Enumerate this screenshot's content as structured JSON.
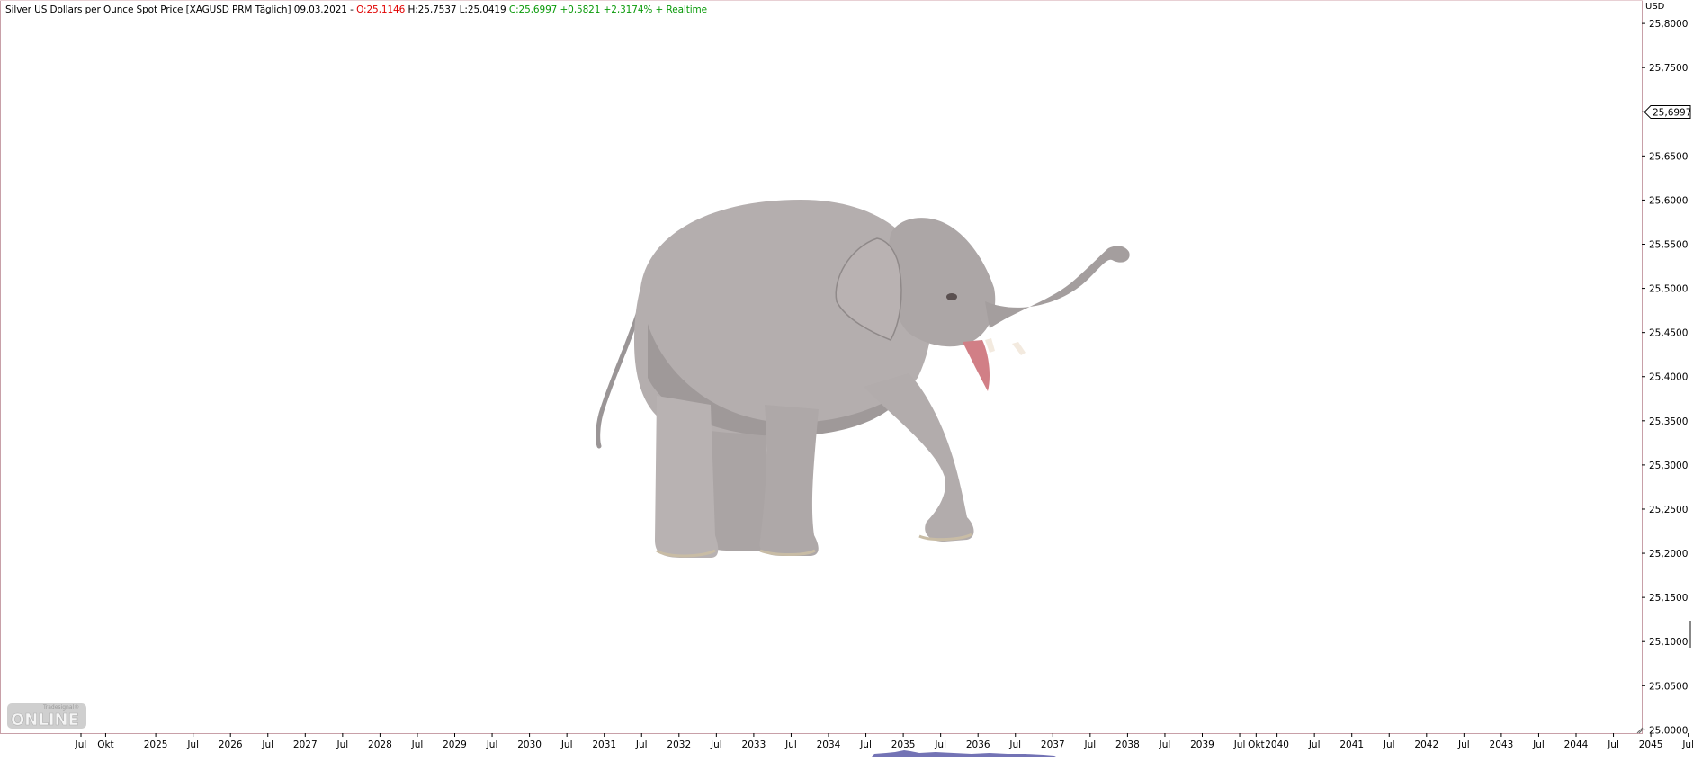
{
  "header": {
    "title": "Silver US Dollars per Ounce Spot Price [XAGUSD PRM Täglich]",
    "date": "09.03.2021",
    "dash": "-",
    "open": "O:25,1146",
    "high": "H:25,7537",
    "low": "L:25,0419",
    "close": "C:25,6997",
    "change": "+0,5821",
    "change_pct": "+2,3174%",
    "realtime": "+ Realtime"
  },
  "logo": {
    "small": "Tradesignal®",
    "big": "ONLINE"
  },
  "colors": {
    "positive": "#0a9a0a",
    "negative": "#e00000",
    "frame": "#c8a0a8",
    "axis": "#000000",
    "volume": "#5a5aa8"
  },
  "chart_data": {
    "type": "line",
    "title": "Silver US Dollars per Ounce Spot Price [XAGUSD PRM Täglich]",
    "currency": "USD",
    "last_price": "25,6997",
    "y_ticks": [
      "25,8000",
      "25,7500",
      "25,7000",
      "25,6500",
      "25,6000",
      "25,5500",
      "25,5000",
      "25,4500",
      "25,4000",
      "25,3500",
      "25,3000",
      "25,2500",
      "25,2000",
      "25,1500",
      "25,1000",
      "25,0500",
      "25,0000"
    ],
    "y_values": [
      25.8,
      25.75,
      25.7,
      25.65,
      25.6,
      25.55,
      25.5,
      25.45,
      25.4,
      25.35,
      25.3,
      25.25,
      25.2,
      25.15,
      25.1,
      25.05,
      25.0
    ],
    "last_value": 25.6997,
    "ylim": [
      24.9963,
      25.8266
    ],
    "x_ticks": [
      "Jul",
      "Okt",
      "2025",
      "Jul",
      "2026",
      "Jul",
      "2027",
      "Jul",
      "2028",
      "Jul",
      "2029",
      "Jul",
      "2030",
      "Jul",
      "2031",
      "Jul",
      "2032",
      "Jul",
      "2033",
      "Jul",
      "2034",
      "Jul",
      "2035",
      "Jul",
      "2036",
      "Jul",
      "2037",
      "Jul",
      "2038",
      "Jul",
      "2039",
      "Jul",
      "Okt",
      "2040",
      "Jul",
      "2041",
      "Jul",
      "2042",
      "Jul",
      "2043",
      "Jul",
      "2044",
      "Jul",
      "2045",
      "Jul"
    ],
    "x_tick_index": [
      0,
      0.33,
      1,
      1.5,
      2,
      2.5,
      3,
      3.5,
      4,
      4.5,
      5,
      5.5,
      6,
      6.5,
      7,
      7.5,
      8,
      8.5,
      9,
      9.5,
      10,
      10.5,
      11,
      11.5,
      12,
      12.5,
      13,
      13.5,
      14,
      14.5,
      15,
      15.5,
      15.72,
      16,
      16.5,
      17,
      17.5,
      18,
      18.5,
      19,
      19.5,
      20,
      20.5,
      21,
      21.5
    ],
    "grid": false,
    "legend": "none"
  }
}
